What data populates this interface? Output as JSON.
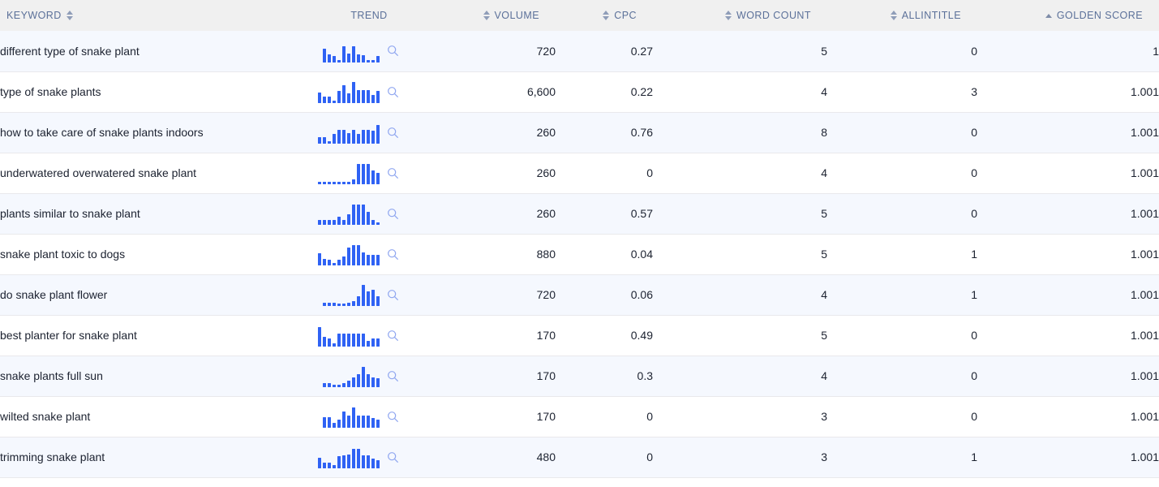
{
  "table": {
    "columns": [
      {
        "key": "keyword",
        "label": "KEYWORD",
        "align": "left",
        "sort": "both",
        "icon": "sort-both-icon"
      },
      {
        "key": "trend",
        "label": "TREND",
        "align": "center",
        "sort": "none",
        "icon": ""
      },
      {
        "key": "volume",
        "label": "VOLUME",
        "align": "right",
        "sort": "both",
        "icon": "sort-both-icon"
      },
      {
        "key": "cpc",
        "label": "CPC",
        "align": "right",
        "sort": "both",
        "icon": "sort-both-icon"
      },
      {
        "key": "word_count",
        "label": "WORD COUNT",
        "align": "right",
        "sort": "both",
        "icon": "sort-both-icon"
      },
      {
        "key": "allintitle",
        "label": "ALLINTITLE",
        "align": "right",
        "sort": "both",
        "icon": "sort-both-icon"
      },
      {
        "key": "golden_score",
        "label": "GOLDEN SCORE",
        "align": "right",
        "sort": "asc",
        "icon": "sort-asc-icon"
      }
    ],
    "row_action_icon": "search-magnifier-icon",
    "rows": [
      {
        "keyword": "different type of snake plant",
        "volume": "720",
        "cpc": "0.27",
        "word_count": "5",
        "allintitle": "0",
        "golden_score": "1",
        "trend": [
          62,
          34,
          30,
          12,
          72,
          40,
          70,
          34,
          32,
          12,
          12,
          30
        ]
      },
      {
        "keyword": "type of snake plants",
        "volume": "6,600",
        "cpc": "0.22",
        "word_count": "4",
        "allintitle": "3",
        "golden_score": "1.001",
        "trend": [
          46,
          30,
          28,
          12,
          52,
          78,
          44,
          92,
          58,
          58,
          58,
          34,
          54
        ]
      },
      {
        "keyword": "how to take care of snake plants indoors",
        "volume": "260",
        "cpc": "0.76",
        "word_count": "8",
        "allintitle": "0",
        "golden_score": "1.001",
        "trend": [
          30,
          28,
          12,
          42,
          62,
          62,
          48,
          62,
          44,
          62,
          62,
          58,
          82
        ]
      },
      {
        "keyword": "underwatered overwatered snake plant",
        "volume": "260",
        "cpc": "0",
        "word_count": "4",
        "allintitle": "0",
        "golden_score": "1.001",
        "trend": [
          10,
          10,
          10,
          10,
          10,
          10,
          10,
          20,
          88,
          88,
          88,
          60,
          50
        ]
      },
      {
        "keyword": "plants similar to snake plant",
        "volume": "260",
        "cpc": "0.57",
        "word_count": "5",
        "allintitle": "0",
        "golden_score": "1.001",
        "trend": [
          22,
          22,
          22,
          22,
          34,
          22,
          46,
          88,
          88,
          88,
          58,
          20,
          10
        ]
      },
      {
        "keyword": "snake plant toxic to dogs",
        "volume": "880",
        "cpc": "0.04",
        "word_count": "5",
        "allintitle": "1",
        "golden_score": "1.001",
        "trend": [
          52,
          30,
          24,
          12,
          24,
          40,
          78,
          88,
          88,
          58,
          46,
          46,
          46
        ]
      },
      {
        "keyword": "do snake plant flower",
        "volume": "720",
        "cpc": "0.06",
        "word_count": "4",
        "allintitle": "1",
        "golden_score": "1.001",
        "trend": [
          14,
          14,
          14,
          10,
          10,
          16,
          22,
          44,
          92,
          66,
          70,
          42
        ]
      },
      {
        "keyword": "best planter for snake plant",
        "volume": "170",
        "cpc": "0.49",
        "word_count": "5",
        "allintitle": "0",
        "golden_score": "1.001",
        "trend": [
          86,
          44,
          36,
          14,
          56,
          56,
          56,
          56,
          56,
          56,
          26,
          34,
          34
        ]
      },
      {
        "keyword": "snake plants full sun",
        "volume": "170",
        "cpc": "0.3",
        "word_count": "4",
        "allintitle": "0",
        "golden_score": "1.001",
        "trend": [
          18,
          18,
          12,
          12,
          18,
          30,
          42,
          56,
          88,
          56,
          44,
          40
        ]
      },
      {
        "keyword": "wilted snake plant",
        "volume": "170",
        "cpc": "0",
        "word_count": "3",
        "allintitle": "0",
        "golden_score": "1.001",
        "trend": [
          48,
          48,
          20,
          34,
          72,
          52,
          88,
          52,
          52,
          52,
          44,
          34
        ]
      },
      {
        "keyword": "trimming snake plant",
        "volume": "480",
        "cpc": "0",
        "word_count": "3",
        "allintitle": "1",
        "golden_score": "1.001",
        "trend": [
          46,
          26,
          26,
          16,
          52,
          58,
          60,
          86,
          86,
          58,
          58,
          44,
          36
        ]
      }
    ]
  },
  "colors": {
    "header_bg": "#f0f0f0",
    "header_text": "#5b7099",
    "row_alt_bg": "#f5f8fe",
    "row_bg": "#ffffff",
    "spark_bar": "#2f62f4",
    "magnifier": "#8fa6f0"
  }
}
